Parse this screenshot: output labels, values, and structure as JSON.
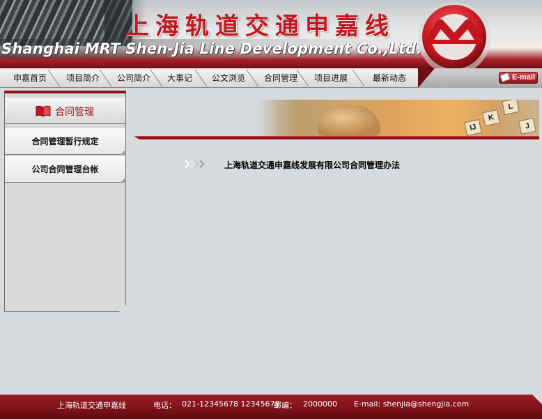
{
  "header": {
    "title_cn": "上海轨道交通申嘉线",
    "title_en": "Shanghai MRT Shen-Jia Line Development Co.,Ltd."
  },
  "nav": {
    "items": [
      {
        "label": "申嘉首页"
      },
      {
        "label": "项目简介"
      },
      {
        "label": "公司简介"
      },
      {
        "label": "大事记"
      },
      {
        "label": "公文浏览"
      },
      {
        "label": "合同管理"
      },
      {
        "label": "项目进展"
      },
      {
        "label": "最新动态"
      }
    ],
    "email_label": "E-mail"
  },
  "sidebar": {
    "title": "合同管理",
    "items": [
      {
        "label": "合同管理暂行规定"
      },
      {
        "label": "公司合同管理台帐"
      }
    ]
  },
  "banner": {
    "keys": [
      "J",
      "K",
      "L",
      "IJ"
    ]
  },
  "content": {
    "link_text": "上海轨道交通申嘉线发展有限公司合同管理办法"
  },
  "footer": {
    "company": "上海轨道交通申嘉线",
    "phone_label": "电话：",
    "phone": "021-12345678  12345678",
    "postcode_label": "邮编：",
    "postcode": "2000000",
    "email": "E-mail: shenjia@shengjia.com"
  },
  "colors": {
    "brand_red": "#8e1319",
    "accent_red": "#c3161e",
    "background": "#d7dbde"
  }
}
